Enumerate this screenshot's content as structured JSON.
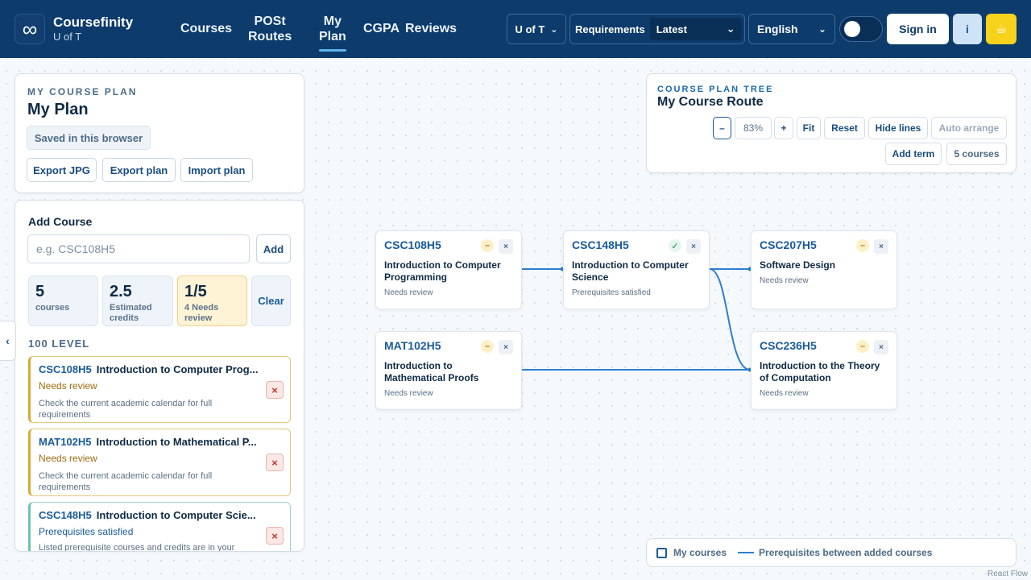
{
  "brand": {
    "logo_symbol": "∞",
    "name": "Coursefinity",
    "school": "U of T"
  },
  "nav": {
    "links": [
      {
        "l1": "Courses",
        "l2": ""
      },
      {
        "l1": "POSt",
        "l2": "Routes"
      },
      {
        "l1": "My",
        "l2": "Plan"
      },
      {
        "l1": "CGPA",
        "l2": ""
      },
      {
        "l1": "Reviews",
        "l2": ""
      }
    ],
    "school_select": "U of T",
    "requirements_label": "Requirements",
    "requirements_value": "Latest",
    "language": "English",
    "sign_in": "Sign in",
    "info": "i",
    "coffee_icon": "coffee-icon"
  },
  "plan_panel": {
    "eyebrow": "MY COURSE PLAN",
    "title": "My Plan",
    "saved": "Saved in this browser",
    "export_jpg": "Export JPG",
    "export_plan": "Export plan",
    "import_plan": "Import plan"
  },
  "add_course": {
    "title": "Add Course",
    "placeholder": "e.g. CSC108H5",
    "add_label": "Add",
    "stats": [
      {
        "value": "5",
        "label": "courses"
      },
      {
        "value": "2.5",
        "label": "Estimated credits"
      },
      {
        "value": "1/5",
        "label": "4 Needs review"
      }
    ],
    "clear_label": "Clear",
    "level": "100 LEVEL",
    "courses": [
      {
        "code": "CSC108H5",
        "title": "Introduction to Computer Prog...",
        "status": "Needs review",
        "note": "Check the current academic calendar for full requirements"
      },
      {
        "code": "MAT102H5",
        "title": "Introduction to Mathematical P...",
        "status": "Needs review",
        "note": "Check the current academic calendar for full requirements"
      },
      {
        "code": "CSC148H5",
        "title": "Introduction to Computer Scie...",
        "status": "Prerequisites satisfied",
        "note": "Listed prerequisite courses and credits are in your"
      }
    ]
  },
  "tree": {
    "eyebrow": "COURSE PLAN TREE",
    "title": "My Course Route",
    "zoom_out": "–",
    "zoom": "83%",
    "zoom_in": "+",
    "fit": "Fit",
    "reset": "Reset",
    "hide_lines": "Hide lines",
    "auto_arrange": "Auto arrange",
    "add_term": "Add term",
    "course_count": "5 courses",
    "nodes": [
      {
        "code": "CSC108H5",
        "title": "Introduction to Computer Programming",
        "status": "Needs review",
        "badge": "–"
      },
      {
        "code": "CSC148H5",
        "title": "Introduction to Computer Science",
        "status": "Prerequisites satisfied",
        "badge": "✓"
      },
      {
        "code": "CSC207H5",
        "title": "Software Design",
        "status": "Needs review",
        "badge": "–"
      },
      {
        "code": "MAT102H5",
        "title": "Introduction to Mathematical Proofs",
        "status": "Needs review",
        "badge": "–"
      },
      {
        "code": "CSC236H5",
        "title": "Introduction to the Theory of Computation",
        "status": "Needs review",
        "badge": "–"
      }
    ],
    "remove_symbol": "×"
  },
  "legend": {
    "my_courses": "My courses",
    "prereqs": "Prerequisites between added courses"
  },
  "collapse_symbol": "‹",
  "attribution": "React Flow",
  "colors": {
    "nav": "#0c3b6c",
    "accent": "#1a5b9a",
    "edge": "#2b7fd0",
    "warning": "#d9a93a",
    "coffee": "#f6d21a"
  }
}
